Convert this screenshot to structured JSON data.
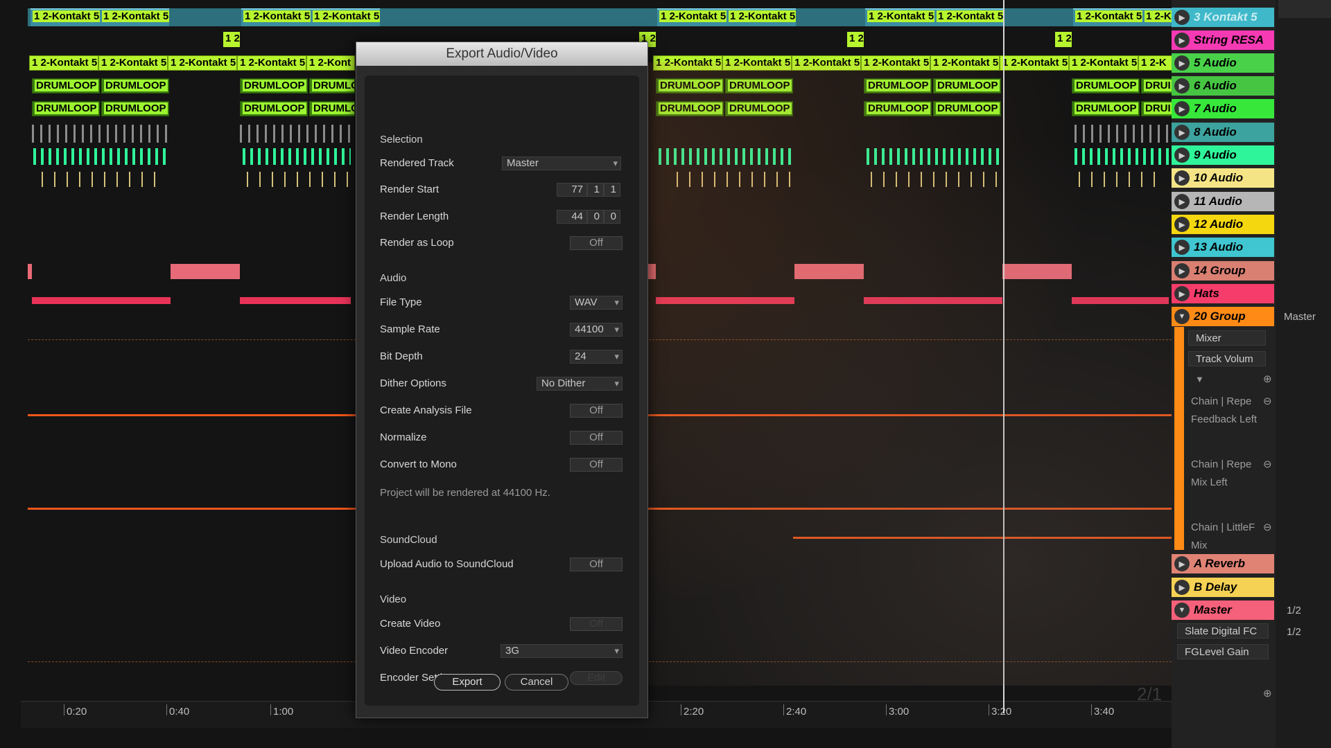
{
  "clips": {
    "kontakt5": "1 2-Kontakt 5",
    "kontakt": "1 2-Kontakt",
    "kontakt_short": "1 2-Kont",
    "kontakt_tiny": "1 2-K",
    "small": "1 2",
    "drumloop": "DRUMLOOP",
    "drumloop_short": "DRUMLC",
    "drumloop_tiny": "DRUI"
  },
  "timeline": {
    "ticks": [
      "0:20",
      "0:40",
      "1:00",
      "2:20",
      "2:40",
      "3:00",
      "3:20",
      "3:40"
    ],
    "page_indicator": "2/1"
  },
  "tracks": [
    {
      "name": "3 Kontakt 5",
      "color": "#3fb9c9"
    },
    {
      "name": "String RESA",
      "color": "#f53ab4"
    },
    {
      "name": "5 Audio",
      "color": "#49d14a"
    },
    {
      "name": "6 Audio",
      "color": "#46c542"
    },
    {
      "name": "7 Audio",
      "color": "#37e83b"
    },
    {
      "name": "8 Audio",
      "color": "#3da39e"
    },
    {
      "name": "9 Audio",
      "color": "#2ff59a"
    },
    {
      "name": "10 Audio",
      "color": "#f5e486"
    },
    {
      "name": "11 Audio",
      "color": "#b6b6b6"
    },
    {
      "name": "12 Audio",
      "color": "#f5d70f"
    },
    {
      "name": "13 Audio",
      "color": "#3fc6d0"
    },
    {
      "name": "14 Group",
      "color": "#d98072"
    },
    {
      "name": "Hats",
      "color": "#f53c6a"
    },
    {
      "name": "20 Group",
      "color": "#ff8a16"
    }
  ],
  "group_devices": {
    "mixer": "Mixer",
    "track_volume": "Track Volum",
    "chain1": "Chain | Repe",
    "feedback_left": "Feedback Left",
    "chain2": "Chain | Repe",
    "mix_left": "Mix Left",
    "chain3": "Chain | LittleF",
    "mix": "Mix"
  },
  "return_tracks": [
    {
      "name": "A Reverb",
      "color": "#e08375"
    },
    {
      "name": "B Delay",
      "color": "#f5d253"
    },
    {
      "name": "Master",
      "color": "#f5607a"
    }
  ],
  "master_devices": {
    "slate": "Slate Digital FC",
    "fglevel": "FGLevel Gain"
  },
  "right_column": {
    "master": "Master",
    "io1": "1/2",
    "io2": "1/2"
  },
  "dialog": {
    "title": "Export Audio/Video",
    "selection_header": "Selection",
    "rendered_track_label": "Rendered Track",
    "rendered_track_value": "Master",
    "render_start_label": "Render Start",
    "render_start": [
      "77",
      "1",
      "1"
    ],
    "render_length_label": "Render Length",
    "render_length": [
      "44",
      "0",
      "0"
    ],
    "render_loop_label": "Render as Loop",
    "render_loop_value": "Off",
    "audio_header": "Audio",
    "file_type_label": "File Type",
    "file_type_value": "WAV",
    "sample_rate_label": "Sample Rate",
    "sample_rate_value": "44100",
    "bit_depth_label": "Bit Depth",
    "bit_depth_value": "24",
    "dither_label": "Dither Options",
    "dither_value": "No Dither",
    "analysis_label": "Create Analysis File",
    "analysis_value": "Off",
    "normalize_label": "Normalize",
    "normalize_value": "Off",
    "mono_label": "Convert to Mono",
    "mono_value": "Off",
    "info_text": "Project will be rendered at 44100 Hz.",
    "soundcloud_header": "SoundCloud",
    "upload_label": "Upload Audio to SoundCloud",
    "upload_value": "Off",
    "video_header": "Video",
    "create_video_label": "Create Video",
    "create_video_value": "Off",
    "encoder_label": "Video Encoder",
    "encoder_value": "3G",
    "encoder_settings_label": "Encoder Settings",
    "encoder_settings_value": "Edit",
    "export_button": "Export",
    "cancel_button": "Cancel"
  }
}
